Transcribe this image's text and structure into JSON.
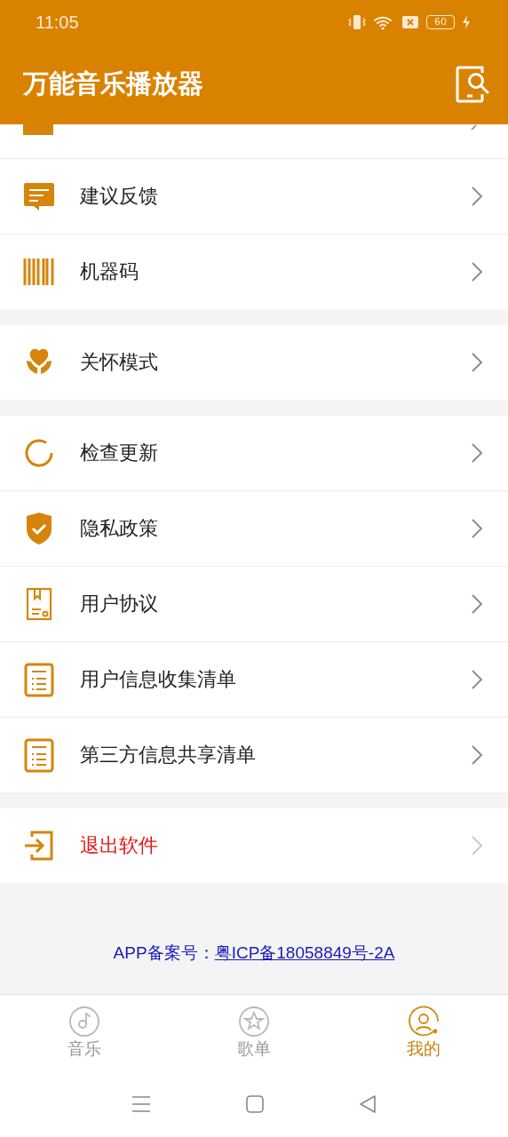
{
  "status_bar": {
    "time": "11:05",
    "battery": "60"
  },
  "header": {
    "title": "万能音乐播放器"
  },
  "groups": [
    {
      "items": [
        {
          "kind": "normal",
          "label": "建议反馈"
        },
        {
          "kind": "normal",
          "label": "机器码"
        }
      ]
    },
    {
      "items": [
        {
          "kind": "normal",
          "label": "关怀模式"
        }
      ]
    },
    {
      "items": [
        {
          "kind": "normal",
          "label": "检查更新"
        },
        {
          "kind": "normal",
          "label": "隐私政策"
        },
        {
          "kind": "normal",
          "label": "用户协议"
        },
        {
          "kind": "normal",
          "label": "用户信息收集清单"
        },
        {
          "kind": "normal",
          "label": "第三方信息共享清单"
        }
      ]
    },
    {
      "items": [
        {
          "kind": "danger",
          "label": "退出软件"
        }
      ]
    }
  ],
  "footer": {
    "label": "APP备案号：",
    "link": "粤ICP备18058849号-2A"
  },
  "tabs": [
    {
      "label": "音乐",
      "selected": false
    },
    {
      "label": "歌单",
      "selected": false
    },
    {
      "label": "我的",
      "selected": true
    }
  ]
}
